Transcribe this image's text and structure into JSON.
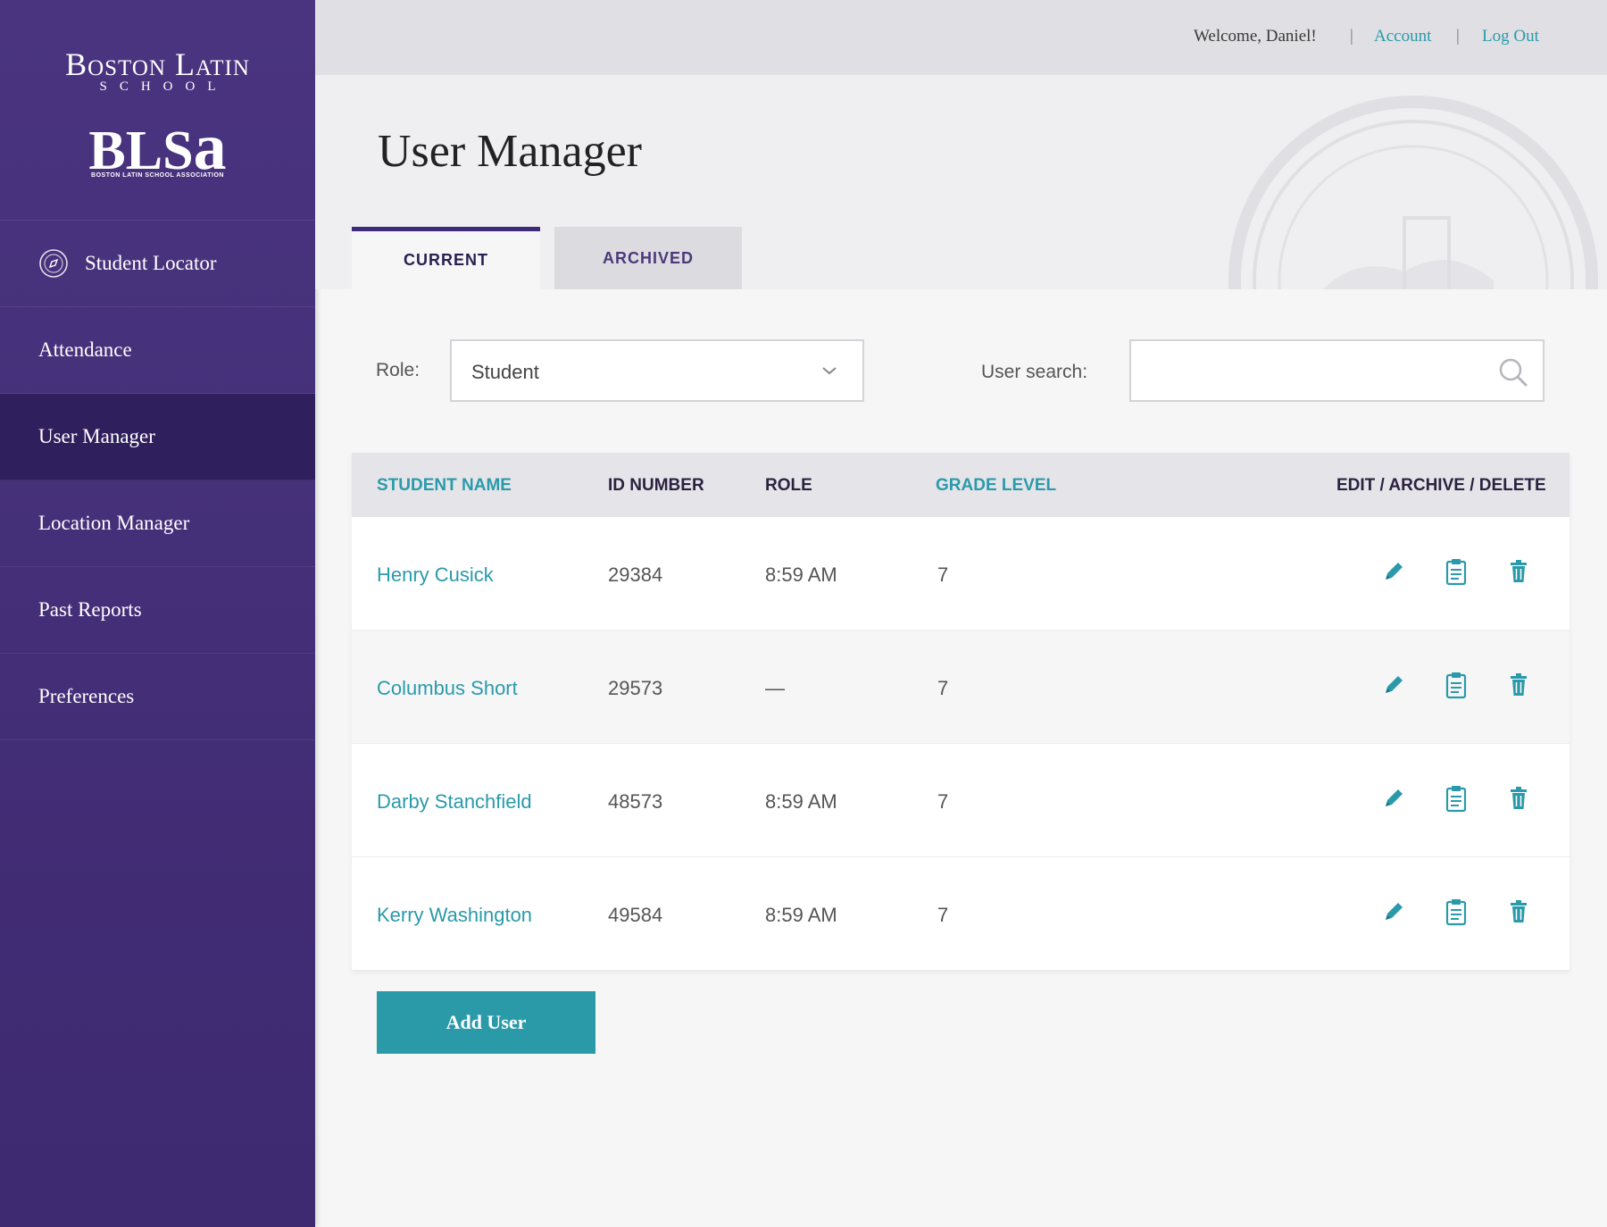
{
  "brand": {
    "name": "Boston Latin",
    "school": "SCHOOL",
    "mark": "BLS",
    "mark_a": "a",
    "association": "BOSTON LATIN SCHOOL ASSOCIATION"
  },
  "sidebar": {
    "items": [
      {
        "label": "Student Locator",
        "icon": "compass-icon"
      },
      {
        "label": "Attendance"
      },
      {
        "label": "User Manager",
        "active": true
      },
      {
        "label": "Location Manager"
      },
      {
        "label": "Past Reports"
      },
      {
        "label": "Preferences"
      }
    ]
  },
  "header": {
    "welcome": "Welcome, Daniel!",
    "separator": "|",
    "account": "Account",
    "logout": "Log Out"
  },
  "page": {
    "title": "User Manager"
  },
  "tabs": [
    {
      "label": "CURRENT",
      "active": true
    },
    {
      "label": "ARCHIVED"
    }
  ],
  "filters": {
    "role_label": "Role:",
    "role_value": "Student",
    "search_label": "User search:",
    "search_value": ""
  },
  "table": {
    "headers": {
      "name": "STUDENT NAME",
      "id": "ID NUMBER",
      "role": "ROLE",
      "grade": "GRADE LEVEL",
      "actions": "EDIT / ARCHIVE / DELETE"
    },
    "rows": [
      {
        "name": "Henry Cusick",
        "id": "29384",
        "role": "8:59 AM",
        "grade": "7"
      },
      {
        "name": "Columbus Short",
        "id": "29573",
        "role": "—",
        "grade": "7"
      },
      {
        "name": "Darby Stanchfield",
        "id": "48573",
        "role": "8:59 AM",
        "grade": "7"
      },
      {
        "name": "Kerry Washington",
        "id": "49584",
        "role": "8:59 AM",
        "grade": "7"
      }
    ]
  },
  "add_button": "Add User",
  "colors": {
    "sidebar": "#4a3480",
    "sidebar_active": "#2f1f5d",
    "accent_teal": "#2a9aaa",
    "tab_indicator": "#3d2a7a"
  }
}
